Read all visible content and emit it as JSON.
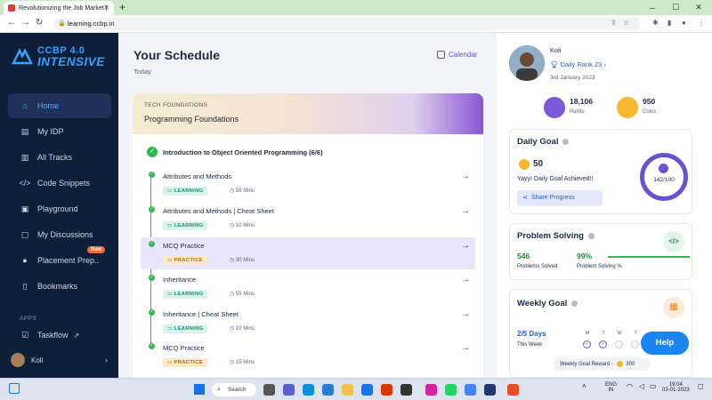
{
  "browser": {
    "tab_title": "Revolutionizing the Job Market |",
    "url": "learning.ccbp.in"
  },
  "sidebar": {
    "logo_line1": "CCBP 4.0",
    "logo_line2": "INTENSIVE",
    "items": [
      {
        "label": "Home",
        "icon": "home-icon",
        "active": true
      },
      {
        "label": "My IDP",
        "icon": "document-icon"
      },
      {
        "label": "All Tracks",
        "icon": "book-icon"
      },
      {
        "label": "Code Snippets",
        "icon": "code-icon"
      },
      {
        "label": "Playground",
        "icon": "terminal-icon"
      },
      {
        "label": "My Discussions",
        "icon": "chat-icon"
      },
      {
        "label": "Placement Prep..",
        "icon": "person-icon"
      },
      {
        "label": "Bookmarks",
        "icon": "bookmark-icon"
      }
    ],
    "new_badge": "New",
    "apps_label": "APPS",
    "taskflow_label": "Taskflow",
    "user_name": "Koli"
  },
  "main": {
    "title": "Your Schedule",
    "subtitle": "Today",
    "calendar_label": "Calendar",
    "course_category": "TECH FOUNDATIONS",
    "course_name": "Programming Foundations",
    "section_title": "Introduction to Object Oriented Programming (6/6)",
    "items": [
      {
        "title": "Attributes and Methods",
        "tag": "LEARNING",
        "duration": "55 Mins"
      },
      {
        "title": "Attributes and Methods | Cheat Sheet",
        "tag": "LEARNING",
        "duration": "10 Mins"
      },
      {
        "title": "MCQ Practice",
        "tag": "PRACTICE",
        "duration": "30 Mins"
      },
      {
        "title": "Inheritance",
        "tag": "LEARNING",
        "duration": "55 Mins"
      },
      {
        "title": "Inheritance | Cheat Sheet",
        "tag": "LEARNING",
        "duration": "10 Mins"
      },
      {
        "title": "MCQ Practice",
        "tag": "PRACTICE",
        "duration": "15 Mins"
      }
    ]
  },
  "profile": {
    "name": "Koli",
    "rank": "Daily Rank 23",
    "date": "3rd January 2023",
    "points_value": "18,106",
    "points_label": "Points",
    "coins_value": "950",
    "coins_label": "Coins"
  },
  "daily_goal": {
    "title": "Daily Goal",
    "value": "50",
    "message": "Yayy! Daily Goal Achieved!!",
    "share_label": "Share Progress",
    "progress": "142/100"
  },
  "problem_solving": {
    "title": "Problem Solving",
    "solved_value": "546",
    "solved_label": "Problems Solved",
    "percent_value": "99%",
    "percent_label": "Problem Solving %"
  },
  "weekly_goal": {
    "title": "Weekly Goal",
    "days_value": "2/5 Days",
    "days_label": "This Week",
    "days": [
      "M",
      "T",
      "W",
      "T"
    ],
    "reward_label": "Weekly Goal Reward -",
    "reward_value": "300"
  },
  "help_label": "Help",
  "taskbar": {
    "search_label": "Search",
    "lang": "ENG",
    "region": "IN",
    "time": "19:04",
    "date": "03-01-2023"
  }
}
